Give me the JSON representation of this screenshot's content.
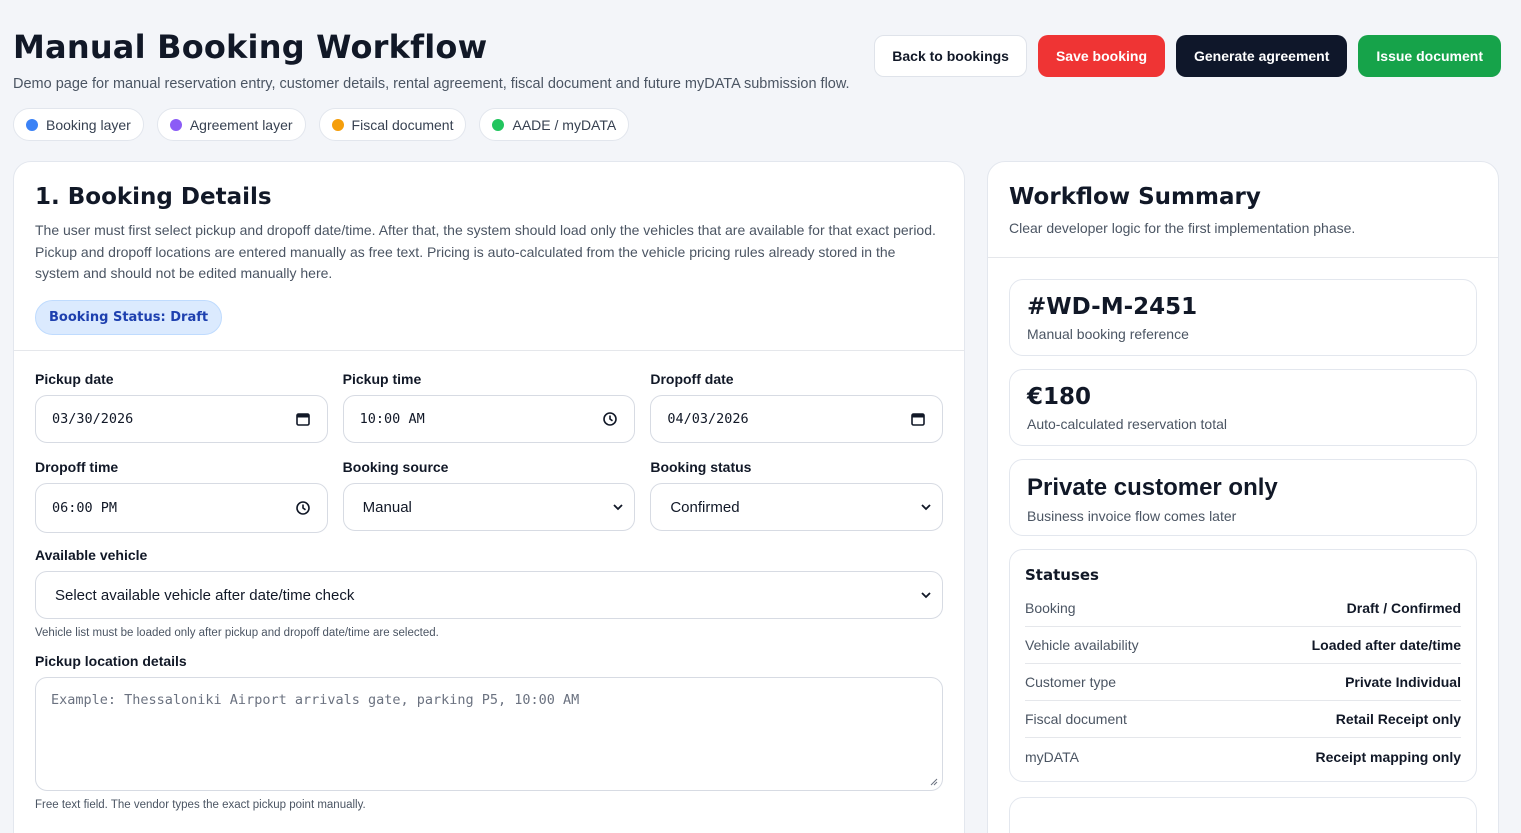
{
  "header": {
    "title": "Manual Booking Workflow",
    "subtitle": "Demo page for manual reservation entry, customer details, rental agreement, fiscal document and future myDATA submission flow."
  },
  "actions": {
    "back": "Back to bookings",
    "save": "Save booking",
    "generate": "Generate agreement",
    "issue": "Issue document"
  },
  "legend": [
    {
      "label": "Booking layer",
      "color": "#3b82f6"
    },
    {
      "label": "Agreement layer",
      "color": "#8b5cf6"
    },
    {
      "label": "Fiscal document",
      "color": "#f59e0b"
    },
    {
      "label": "AADE / myDATA",
      "color": "#22c55e"
    }
  ],
  "booking": {
    "title": "1. Booking Details",
    "description": "The user must first select pickup and dropoff date/time. After that, the system should load only the vehicles that are available for that exact period. Pickup and dropoff locations are entered manually as free text. Pricing is auto-calculated from the vehicle pricing rules already stored in the system and should not be edited manually here.",
    "status_chip": "Booking Status: Draft",
    "fields": {
      "pickup_date": {
        "label": "Pickup date",
        "value": "03/30/2026"
      },
      "pickup_time": {
        "label": "Pickup time",
        "value": "10:00 AM"
      },
      "dropoff_date": {
        "label": "Dropoff date",
        "value": "04/03/2026"
      },
      "dropoff_time": {
        "label": "Dropoff time",
        "value": "06:00 PM"
      },
      "booking_source": {
        "label": "Booking source",
        "value": "Manual"
      },
      "booking_status": {
        "label": "Booking status",
        "value": "Confirmed"
      },
      "vehicle": {
        "label": "Available vehicle",
        "value": "Select available vehicle after date/time check",
        "hint": "Vehicle list must be loaded only after pickup and dropoff date/time are selected."
      },
      "pickup_location": {
        "label": "Pickup location details",
        "placeholder": "Example: Thessaloniki Airport arrivals gate, parking P5, 10:00 AM",
        "hint": "Free text field. The vendor types the exact pickup point manually."
      }
    }
  },
  "summary": {
    "title": "Workflow Summary",
    "description": "Clear developer logic for the first implementation phase.",
    "reference": {
      "value": "#WD-M-2451",
      "label": "Manual booking reference"
    },
    "total": {
      "value": "€180",
      "label": "Auto-calculated reservation total"
    },
    "customer": {
      "value": "Private customer only",
      "label": "Business invoice flow comes later"
    },
    "statuses": {
      "title": "Statuses",
      "rows": [
        {
          "key": "Booking",
          "value": "Draft / Confirmed"
        },
        {
          "key": "Vehicle availability",
          "value": "Loaded after date/time"
        },
        {
          "key": "Customer type",
          "value": "Private Individual"
        },
        {
          "key": "Fiscal document",
          "value": "Retail Receipt only"
        },
        {
          "key": "myDATA",
          "value": "Receipt mapping only"
        }
      ]
    }
  }
}
